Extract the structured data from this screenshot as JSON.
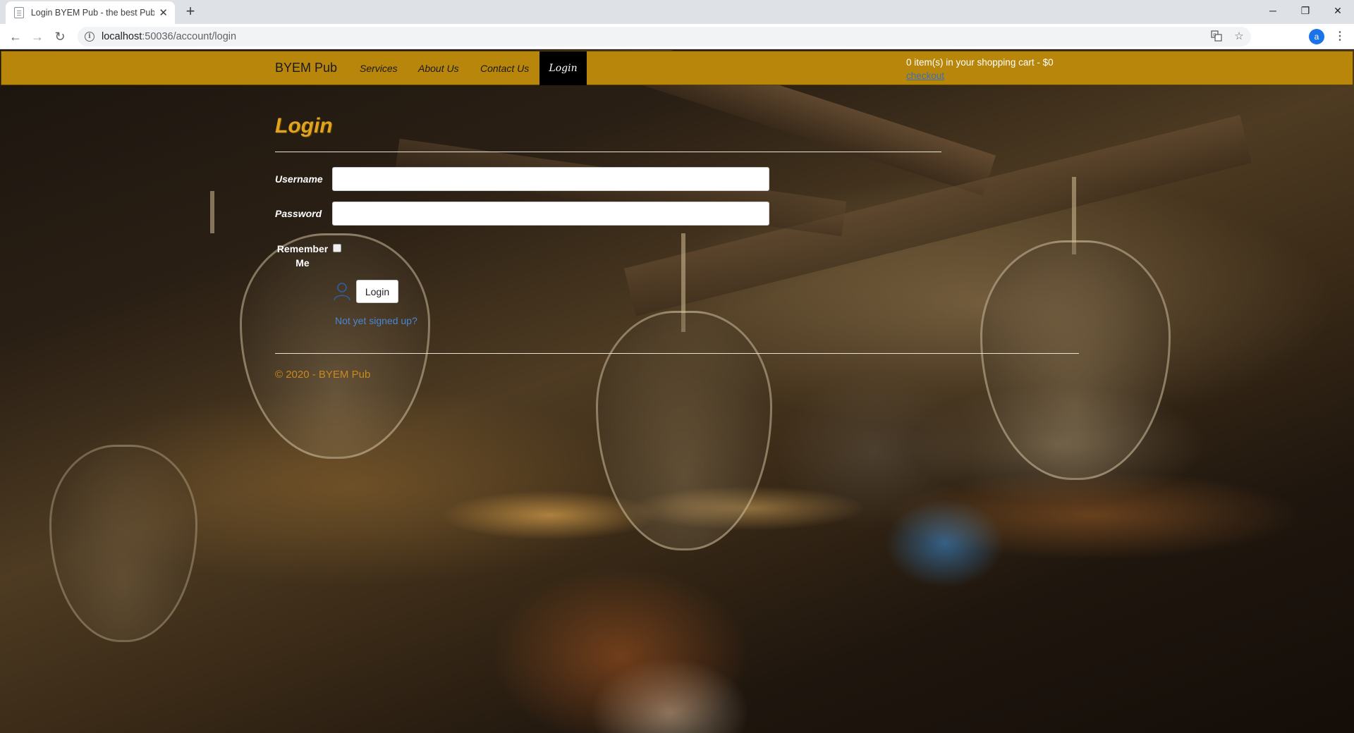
{
  "browser": {
    "tab_title": "Login BYEM Pub - the best Pub",
    "url_host": "localhost",
    "url_path": ":50036/account/login",
    "profile_initial": "a"
  },
  "navbar": {
    "brand": "BYEM Pub",
    "links": [
      "Services",
      "About Us",
      "Contact Us"
    ],
    "active_link": "Login",
    "cart_text": "0 item(s) in your shopping cart - $0",
    "cart_link": "checkout"
  },
  "login": {
    "title": "Login",
    "username_label": "Username",
    "username_value": "",
    "password_label": "Password",
    "password_value": "",
    "remember_label": "Remember Me",
    "remember_checked": false,
    "submit_label": "Login",
    "signup_link": "Not yet signed up?"
  },
  "footer": {
    "text": "© 2020 - BYEM Pub"
  },
  "colors": {
    "navbar_bg": "#b8860b",
    "title": "#e0a421",
    "link": "#4a86d4"
  }
}
